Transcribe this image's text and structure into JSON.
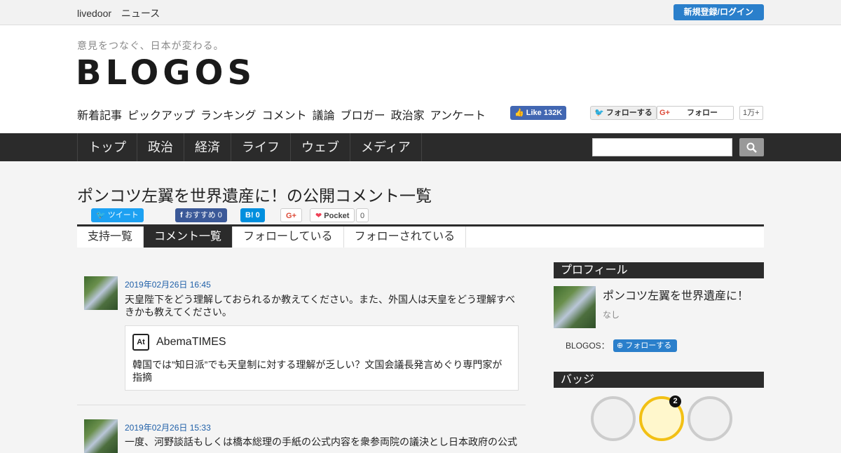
{
  "topbar": {
    "brand": "livedoor",
    "section": "ニュース",
    "login": "新規登録/ログイン"
  },
  "header": {
    "tagline": "意見をつなぐ、日本が変わる。",
    "logo": "BLOGOS",
    "subnav": [
      "新着記事",
      "ピックアップ",
      "ランキング",
      "コメント",
      "議論",
      "ブロガー",
      "政治家",
      "アンケート"
    ],
    "fb_like": "Like 132K",
    "tw_follow": "フォローする",
    "gp_follow": "フォロー",
    "gp_count": "1万+"
  },
  "mainnav": [
    "トップ",
    "政治",
    "経済",
    "ライフ",
    "ウェブ",
    "メディア"
  ],
  "page": {
    "title": "ポンコツ左翼を世界遺産に！の公開コメント一覧",
    "share": {
      "tweet": "ツイート",
      "fb": "おすすめ 0",
      "hatena": "0",
      "gplus": "G+",
      "pocket": "Pocket",
      "pocket_count": "0"
    },
    "tabs": [
      "支持一覧",
      "コメント一覧",
      "フォローしている",
      "フォローされている"
    ]
  },
  "comments": [
    {
      "date": "2019年02月26日 16:45",
      "text": "天皇陛下をどう理解しておられるか教えてください。また、外国人は天皇をどう理解すべきかも教えてください。",
      "card": {
        "logo": "At",
        "source": "AbemaTIMES",
        "title": "韓国では”知日派”でも天皇制に対する理解が乏しい？文国会議長発言めぐり専門家が指摘"
      }
    },
    {
      "date": "2019年02月26日 15:33",
      "text": "一度、河野談話もしくは橋本総理の手紙の公式内容を衆参両院の議決とし日本政府の公式"
    }
  ],
  "sidebar": {
    "profile_head": "プロフィール",
    "name": "ポンコツ左翼を世界遺産に！",
    "desc": "なし",
    "blogos_label": "BLOGOS：",
    "follow": "フォローする",
    "badge_head": "バッジ",
    "badge_count": "2"
  }
}
